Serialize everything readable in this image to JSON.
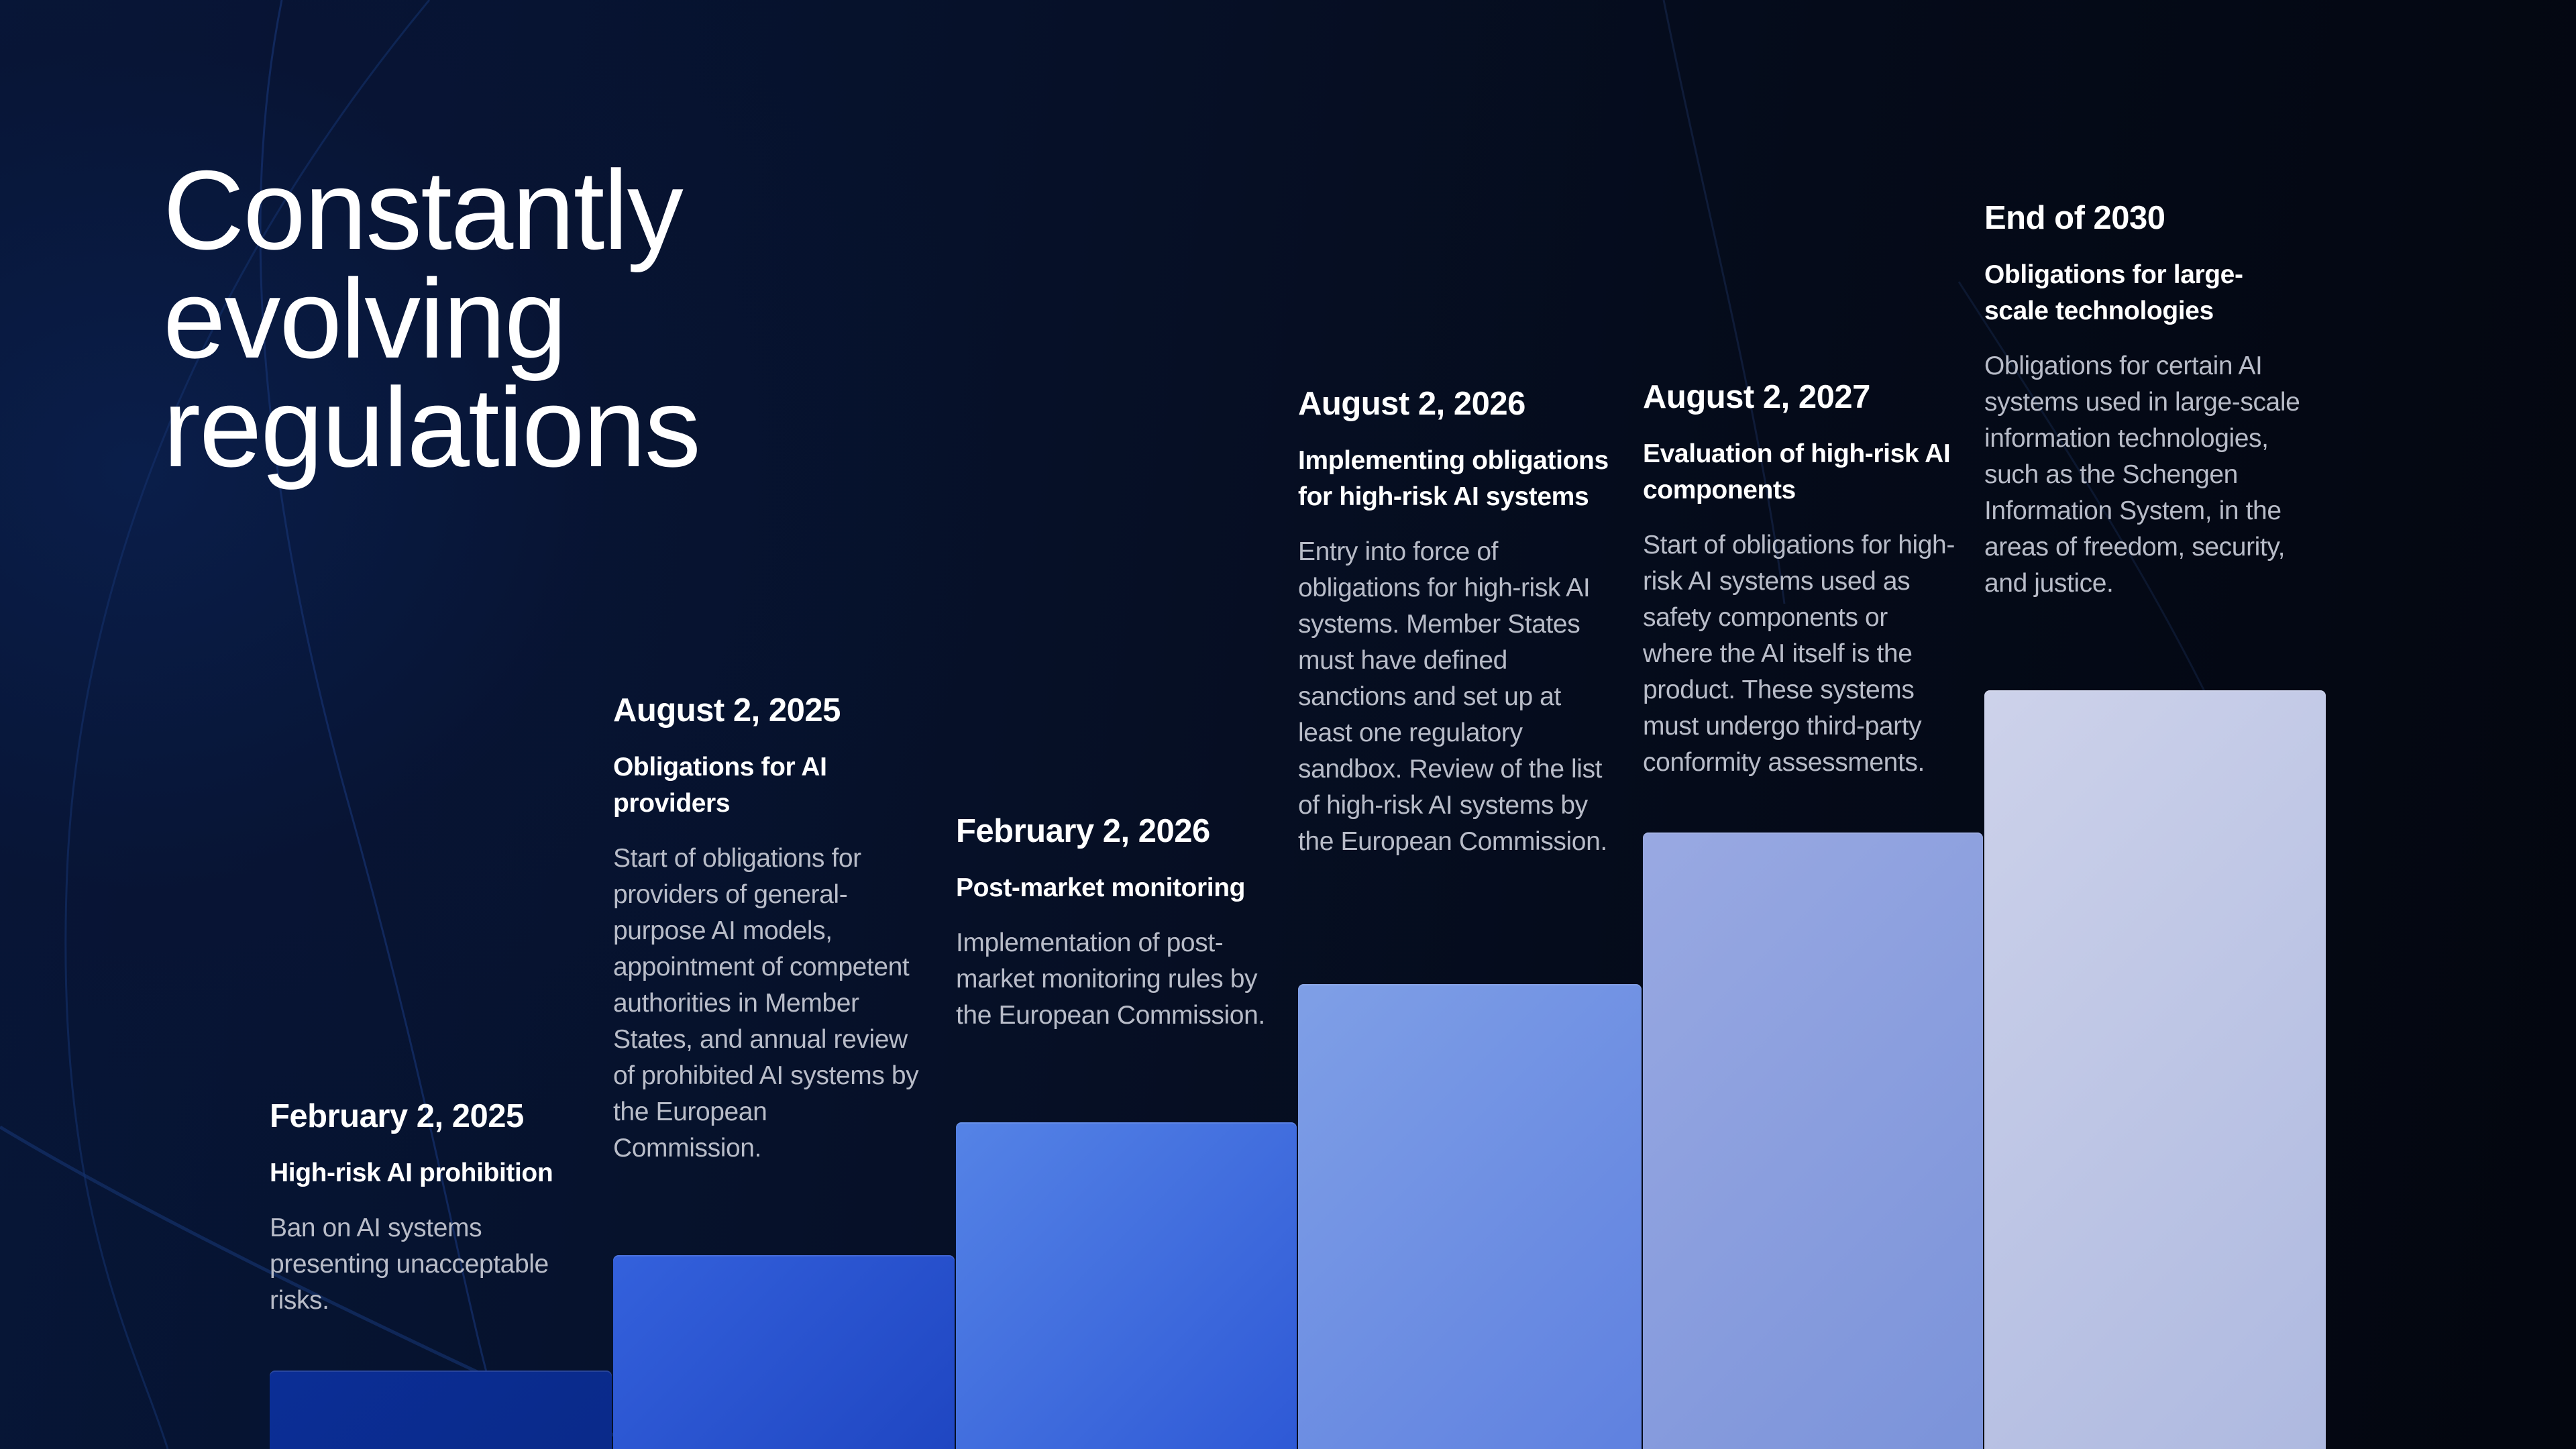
{
  "title": {
    "lines": [
      "Constantly",
      "evolving",
      "regulations"
    ]
  },
  "milestones": [
    {
      "date": "February 2, 2025",
      "heading": "High-risk AI prohibition",
      "description": "Ban on AI systems presenting unacceptable risks.",
      "step": 1,
      "color_start": "#0b2e96",
      "color_end": "#0a2a8a"
    },
    {
      "date": "August 2, 2025",
      "heading": "Obligations for AI providers",
      "description": "Start of obligations for providers of general-purpose AI models, appointment of competent authorities in Member States, and annual review of prohibited AI systems by the European Commission.",
      "step": 2,
      "color_start": "#3461dc",
      "color_end": "#1f46c2"
    },
    {
      "date": "February 2, 2026",
      "heading": "Post-market monitoring",
      "description": "Implementation of post-market monitoring rules by the European Commission.",
      "step": 3,
      "color_start": "#5583e6",
      "color_end": "#2e59d6"
    },
    {
      "date": "August 2, 2026",
      "heading": "Implementing obligations for high-risk AI systems",
      "description": "Entry into force of obligations for high-risk AI systems. Member States must have defined sanctions and set up at least one regulatory sandbox. Review of the list of high-risk AI systems by the European Commission.",
      "step": 4,
      "color_start": "#7f9fe6",
      "color_end": "#5f81e0"
    },
    {
      "date": "August 2, 2027",
      "heading": "Evaluation of high-risk AI components",
      "description": "Start of obligations for high-risk AI systems used as safety components or where the AI itself is the product. These systems must undergo third-party conformity assessments.",
      "step": 5,
      "color_start": "#99a9e2",
      "color_end": "#7b93da"
    },
    {
      "date": "End of 2030",
      "heading": "Obligations for large-scale technologies",
      "description": "Obligations for certain AI systems used in large-scale information technologies, such as the Schengen Information System, in the areas of freedom, security, and justice.",
      "step": 6,
      "color_start": "#cdd2ea",
      "color_end": "#aeb9e0"
    }
  ]
}
